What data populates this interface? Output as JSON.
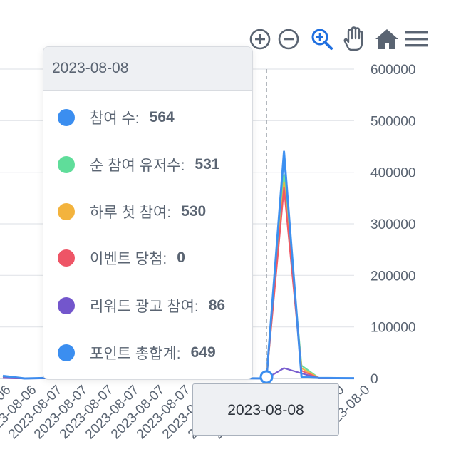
{
  "toolbar": {
    "items": [
      {
        "icon": "zoom-in-circle-icon",
        "active": false
      },
      {
        "icon": "zoom-out-circle-icon",
        "active": false
      },
      {
        "icon": "magnifier-zoom-icon",
        "active": true
      },
      {
        "icon": "pan-hand-icon",
        "active": false
      },
      {
        "icon": "home-reset-icon",
        "active": false
      },
      {
        "icon": "menu-icon",
        "active": false
      }
    ]
  },
  "tooltip": {
    "title": "2023-08-08",
    "rows": [
      {
        "label": "참여 수:",
        "value": "564",
        "color": "#3b8ef0"
      },
      {
        "label": "순 참여 유저수:",
        "value": "531",
        "color": "#5fdd9a"
      },
      {
        "label": "하루 첫 참여:",
        "value": "530",
        "color": "#f3b33d"
      },
      {
        "label": "이벤트 당첨:",
        "value": "0",
        "color": "#ee5566"
      },
      {
        "label": "리워드 광고 참여:",
        "value": "86",
        "color": "#7356cc"
      },
      {
        "label": "포인트 총합계:",
        "value": "649",
        "color": "#3b8ef0"
      }
    ]
  },
  "axis_tooltip": {
    "label": "2023-08-08"
  },
  "chart_data": {
    "type": "line",
    "yaxis_position": "right",
    "ylim": [
      0,
      600000
    ],
    "y_ticks": [
      "0",
      "100000",
      "200000",
      "300000",
      "400000",
      "500000",
      "600000"
    ],
    "x_ticks": [
      "2023-08-06",
      "2023-08-06",
      "2023-08-07",
      "2023-08-07",
      "2023-08-07",
      "2023-08-07",
      "2023-08-07",
      "2023-08-07",
      "2023-08-07",
      "2023-08-07",
      "2023-08-07",
      "2023-08-0",
      "2023-08-0",
      "2023-08-0",
      "2023-08-0"
    ],
    "series": [
      {
        "color": "#3b8ef0",
        "values": [
          4000,
          0,
          700,
          300,
          200,
          400,
          900,
          300,
          500,
          600,
          800,
          300,
          0,
          432000,
          2000,
          800,
          600,
          400
        ]
      },
      {
        "color": "#5fdd9a",
        "values": [
          2000,
          0,
          500,
          250,
          150,
          300,
          800,
          250,
          400,
          500,
          600,
          250,
          0,
          395000,
          25000,
          700,
          500,
          300
        ]
      },
      {
        "color": "#f3b33d",
        "values": [
          1500,
          0,
          400,
          200,
          100,
          250,
          700,
          200,
          300,
          400,
          500,
          200,
          0,
          380000,
          20000,
          600,
          400,
          250
        ]
      },
      {
        "color": "#ee5566",
        "values": [
          1000,
          0,
          300,
          150,
          100,
          200,
          600,
          150,
          250,
          300,
          400,
          150,
          0,
          370000,
          15000,
          500,
          300,
          200
        ]
      },
      {
        "color": "#7356cc",
        "values": [
          800,
          0,
          200,
          100,
          50,
          150,
          400,
          100,
          200,
          250,
          300,
          100,
          0,
          20000,
          10000,
          300,
          200,
          150
        ]
      },
      {
        "color": "#3b8ef0",
        "values": [
          5000,
          0,
          900,
          400,
          300,
          500,
          1100,
          400,
          600,
          700,
          1000,
          400,
          0,
          440000,
          3000,
          900,
          700,
          500
        ]
      }
    ],
    "highlight_index": 12
  }
}
